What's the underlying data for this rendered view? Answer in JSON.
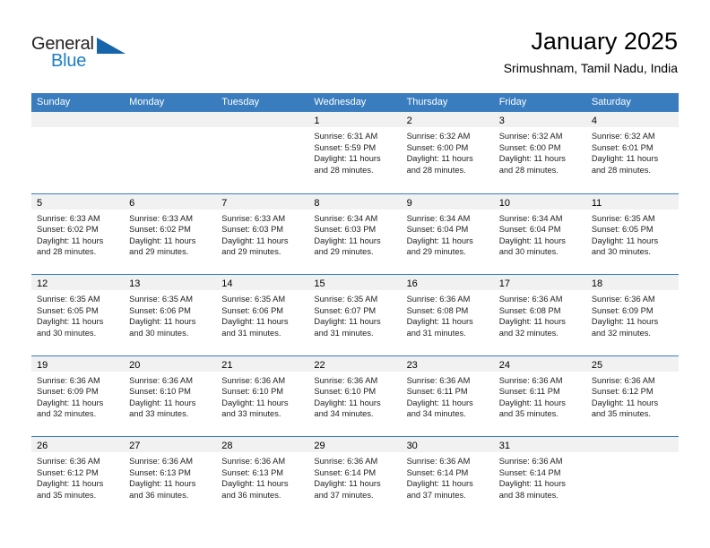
{
  "brand": {
    "name_top": "General",
    "name_bottom": "Blue",
    "triangle_icon": "triangle-icon",
    "color_dark": "#231f20",
    "color_blue": "#1d7fc4",
    "triangle_color": "#1665ab"
  },
  "header": {
    "title": "January 2025",
    "subtitle": "Srimushnam, Tamil Nadu, India"
  },
  "theme": {
    "header_bg": "#3a7dbf",
    "day_strip_bg": "#f1f1f1",
    "text": "#222222"
  },
  "weekdays": [
    "Sunday",
    "Monday",
    "Tuesday",
    "Wednesday",
    "Thursday",
    "Friday",
    "Saturday"
  ],
  "weeks": [
    [
      {
        "empty": true
      },
      {
        "empty": true
      },
      {
        "empty": true
      },
      {
        "day": "1",
        "sunrise": "Sunrise: 6:31 AM",
        "sunset": "Sunset: 5:59 PM",
        "daylight1": "Daylight: 11 hours",
        "daylight2": "and 28 minutes."
      },
      {
        "day": "2",
        "sunrise": "Sunrise: 6:32 AM",
        "sunset": "Sunset: 6:00 PM",
        "daylight1": "Daylight: 11 hours",
        "daylight2": "and 28 minutes."
      },
      {
        "day": "3",
        "sunrise": "Sunrise: 6:32 AM",
        "sunset": "Sunset: 6:00 PM",
        "daylight1": "Daylight: 11 hours",
        "daylight2": "and 28 minutes."
      },
      {
        "day": "4",
        "sunrise": "Sunrise: 6:32 AM",
        "sunset": "Sunset: 6:01 PM",
        "daylight1": "Daylight: 11 hours",
        "daylight2": "and 28 minutes."
      }
    ],
    [
      {
        "day": "5",
        "sunrise": "Sunrise: 6:33 AM",
        "sunset": "Sunset: 6:02 PM",
        "daylight1": "Daylight: 11 hours",
        "daylight2": "and 28 minutes."
      },
      {
        "day": "6",
        "sunrise": "Sunrise: 6:33 AM",
        "sunset": "Sunset: 6:02 PM",
        "daylight1": "Daylight: 11 hours",
        "daylight2": "and 29 minutes."
      },
      {
        "day": "7",
        "sunrise": "Sunrise: 6:33 AM",
        "sunset": "Sunset: 6:03 PM",
        "daylight1": "Daylight: 11 hours",
        "daylight2": "and 29 minutes."
      },
      {
        "day": "8",
        "sunrise": "Sunrise: 6:34 AM",
        "sunset": "Sunset: 6:03 PM",
        "daylight1": "Daylight: 11 hours",
        "daylight2": "and 29 minutes."
      },
      {
        "day": "9",
        "sunrise": "Sunrise: 6:34 AM",
        "sunset": "Sunset: 6:04 PM",
        "daylight1": "Daylight: 11 hours",
        "daylight2": "and 29 minutes."
      },
      {
        "day": "10",
        "sunrise": "Sunrise: 6:34 AM",
        "sunset": "Sunset: 6:04 PM",
        "daylight1": "Daylight: 11 hours",
        "daylight2": "and 30 minutes."
      },
      {
        "day": "11",
        "sunrise": "Sunrise: 6:35 AM",
        "sunset": "Sunset: 6:05 PM",
        "daylight1": "Daylight: 11 hours",
        "daylight2": "and 30 minutes."
      }
    ],
    [
      {
        "day": "12",
        "sunrise": "Sunrise: 6:35 AM",
        "sunset": "Sunset: 6:05 PM",
        "daylight1": "Daylight: 11 hours",
        "daylight2": "and 30 minutes."
      },
      {
        "day": "13",
        "sunrise": "Sunrise: 6:35 AM",
        "sunset": "Sunset: 6:06 PM",
        "daylight1": "Daylight: 11 hours",
        "daylight2": "and 30 minutes."
      },
      {
        "day": "14",
        "sunrise": "Sunrise: 6:35 AM",
        "sunset": "Sunset: 6:06 PM",
        "daylight1": "Daylight: 11 hours",
        "daylight2": "and 31 minutes."
      },
      {
        "day": "15",
        "sunrise": "Sunrise: 6:35 AM",
        "sunset": "Sunset: 6:07 PM",
        "daylight1": "Daylight: 11 hours",
        "daylight2": "and 31 minutes."
      },
      {
        "day": "16",
        "sunrise": "Sunrise: 6:36 AM",
        "sunset": "Sunset: 6:08 PM",
        "daylight1": "Daylight: 11 hours",
        "daylight2": "and 31 minutes."
      },
      {
        "day": "17",
        "sunrise": "Sunrise: 6:36 AM",
        "sunset": "Sunset: 6:08 PM",
        "daylight1": "Daylight: 11 hours",
        "daylight2": "and 32 minutes."
      },
      {
        "day": "18",
        "sunrise": "Sunrise: 6:36 AM",
        "sunset": "Sunset: 6:09 PM",
        "daylight1": "Daylight: 11 hours",
        "daylight2": "and 32 minutes."
      }
    ],
    [
      {
        "day": "19",
        "sunrise": "Sunrise: 6:36 AM",
        "sunset": "Sunset: 6:09 PM",
        "daylight1": "Daylight: 11 hours",
        "daylight2": "and 32 minutes."
      },
      {
        "day": "20",
        "sunrise": "Sunrise: 6:36 AM",
        "sunset": "Sunset: 6:10 PM",
        "daylight1": "Daylight: 11 hours",
        "daylight2": "and 33 minutes."
      },
      {
        "day": "21",
        "sunrise": "Sunrise: 6:36 AM",
        "sunset": "Sunset: 6:10 PM",
        "daylight1": "Daylight: 11 hours",
        "daylight2": "and 33 minutes."
      },
      {
        "day": "22",
        "sunrise": "Sunrise: 6:36 AM",
        "sunset": "Sunset: 6:10 PM",
        "daylight1": "Daylight: 11 hours",
        "daylight2": "and 34 minutes."
      },
      {
        "day": "23",
        "sunrise": "Sunrise: 6:36 AM",
        "sunset": "Sunset: 6:11 PM",
        "daylight1": "Daylight: 11 hours",
        "daylight2": "and 34 minutes."
      },
      {
        "day": "24",
        "sunrise": "Sunrise: 6:36 AM",
        "sunset": "Sunset: 6:11 PM",
        "daylight1": "Daylight: 11 hours",
        "daylight2": "and 35 minutes."
      },
      {
        "day": "25",
        "sunrise": "Sunrise: 6:36 AM",
        "sunset": "Sunset: 6:12 PM",
        "daylight1": "Daylight: 11 hours",
        "daylight2": "and 35 minutes."
      }
    ],
    [
      {
        "day": "26",
        "sunrise": "Sunrise: 6:36 AM",
        "sunset": "Sunset: 6:12 PM",
        "daylight1": "Daylight: 11 hours",
        "daylight2": "and 35 minutes."
      },
      {
        "day": "27",
        "sunrise": "Sunrise: 6:36 AM",
        "sunset": "Sunset: 6:13 PM",
        "daylight1": "Daylight: 11 hours",
        "daylight2": "and 36 minutes."
      },
      {
        "day": "28",
        "sunrise": "Sunrise: 6:36 AM",
        "sunset": "Sunset: 6:13 PM",
        "daylight1": "Daylight: 11 hours",
        "daylight2": "and 36 minutes."
      },
      {
        "day": "29",
        "sunrise": "Sunrise: 6:36 AM",
        "sunset": "Sunset: 6:14 PM",
        "daylight1": "Daylight: 11 hours",
        "daylight2": "and 37 minutes."
      },
      {
        "day": "30",
        "sunrise": "Sunrise: 6:36 AM",
        "sunset": "Sunset: 6:14 PM",
        "daylight1": "Daylight: 11 hours",
        "daylight2": "and 37 minutes."
      },
      {
        "day": "31",
        "sunrise": "Sunrise: 6:36 AM",
        "sunset": "Sunset: 6:14 PM",
        "daylight1": "Daylight: 11 hours",
        "daylight2": "and 38 minutes."
      },
      {
        "empty": true
      }
    ]
  ]
}
